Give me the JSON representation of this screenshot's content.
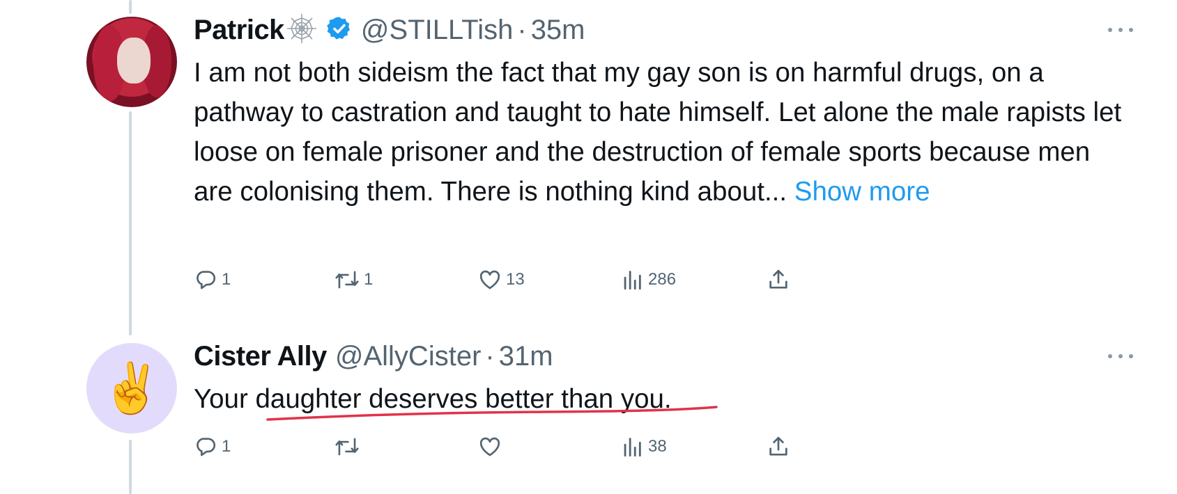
{
  "colors": {
    "accent": "#1d9bf0",
    "text": "#0f1419",
    "muted": "#536471",
    "thread_line": "#cfd9de",
    "underline": "#e0334a"
  },
  "tweets": [
    {
      "display_name": "Patrick",
      "name_badges": [
        "spiderweb-icon",
        "verified-badge-icon"
      ],
      "handle": "@STILLTish",
      "separator": "·",
      "time": "35m",
      "text": "I am not both sideism the fact that my gay son is on harmful drugs, on a pathway to castration and taught to hate himself. Let alone the male rapists let loose on female prisoner and the destruction of female sports because men are colonising them.   There is nothing kind about...",
      "show_more": "Show more",
      "replies": "1",
      "retweets": "1",
      "likes": "13",
      "views": "286"
    },
    {
      "display_name": "Cister Ally",
      "avatar_emoji": "✌️",
      "handle": "@AllyCister",
      "separator": "·",
      "time": "31m",
      "text_prefix": "Your ",
      "text_underlined": "daughter deserves better than you",
      "text_suffix": ".",
      "replies": "1",
      "retweets": "",
      "likes": "",
      "views": "38"
    }
  ]
}
